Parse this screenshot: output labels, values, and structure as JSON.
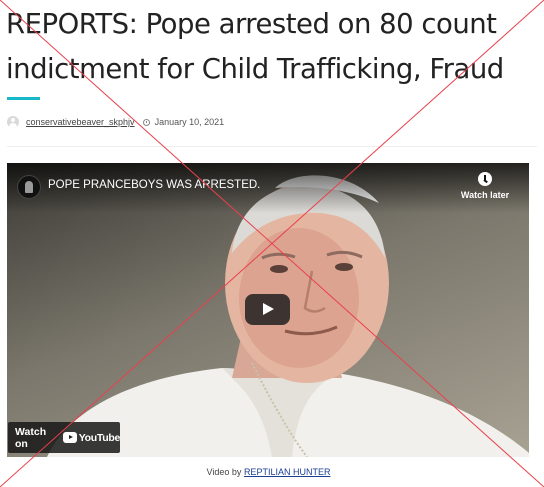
{
  "article": {
    "headline": "REPORTS: Pope arrested on 80 count indictment for Child Trafficking, Fraud",
    "author": "conservativebeaver_skphjv",
    "date": "January 10, 2021"
  },
  "video": {
    "title": "POPE PRANCEBOYS WAS ARRESTED.",
    "watch_later": "Watch later",
    "watch_on": "Watch on",
    "platform": "YouTube"
  },
  "credit": {
    "prefix": "Video by",
    "channel": "REPTILIAN HUNTER"
  },
  "colors": {
    "accent": "#19b8c9",
    "cross": "#e8414c",
    "link": "#1a3f8f"
  },
  "icons": [
    "avatar-icon",
    "clock-icon",
    "channel-icon",
    "watch-later-icon",
    "play-icon",
    "youtube-icon"
  ]
}
